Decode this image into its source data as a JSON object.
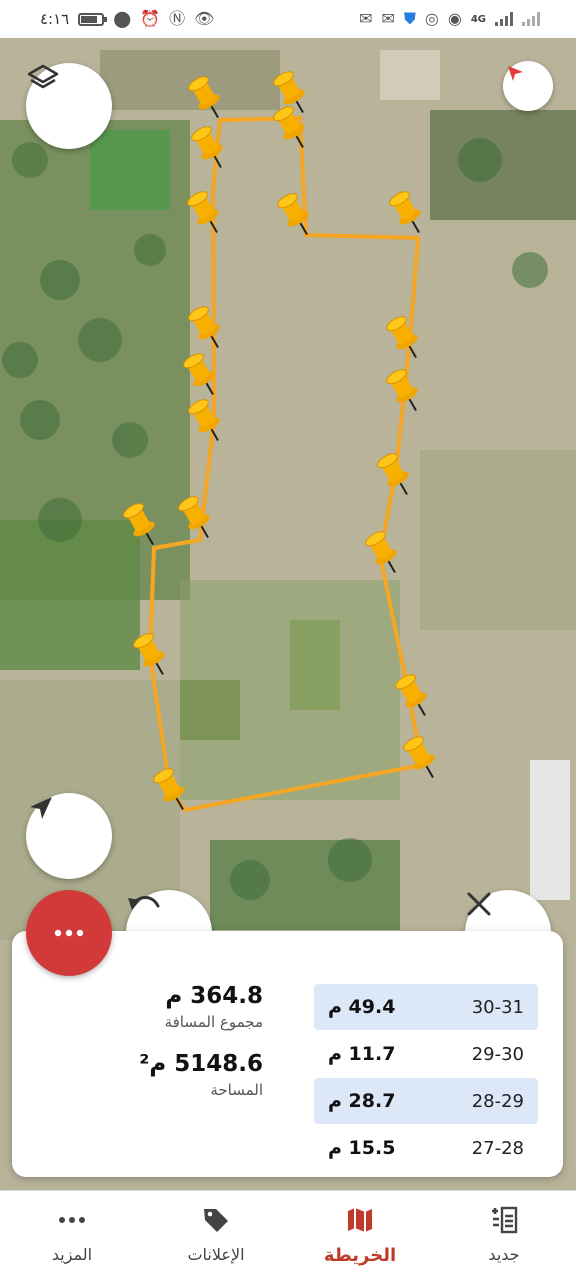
{
  "status_bar": {
    "time": "٤:١٦",
    "network": "4G"
  },
  "map": {
    "route_color": "#f5a623",
    "pin_color": "#f7b000"
  },
  "segments": [
    {
      "id": "30-31",
      "value": "49.4 م",
      "highlighted": true
    },
    {
      "id": "29-30",
      "value": "11.7 م",
      "highlighted": false
    },
    {
      "id": "28-29",
      "value": "28.7 م",
      "highlighted": true
    },
    {
      "id": "27-28",
      "value": "15.5 م",
      "highlighted": false
    }
  ],
  "summary": {
    "distance_value": "364.8 م",
    "distance_label": "مجموع المسافة",
    "area_value": "5148.6 م²",
    "area_label": "المساحة"
  },
  "buttons": {
    "menu_color": "#d23a3a"
  },
  "nav": [
    {
      "label": "جديد",
      "icon": "new-list-icon",
      "active": false
    },
    {
      "label": "الخريطة",
      "icon": "map-icon",
      "active": true
    },
    {
      "label": "الإعلانات",
      "icon": "tag-icon",
      "active": false
    },
    {
      "label": "المزيد",
      "icon": "more-dots-icon",
      "active": false
    }
  ]
}
